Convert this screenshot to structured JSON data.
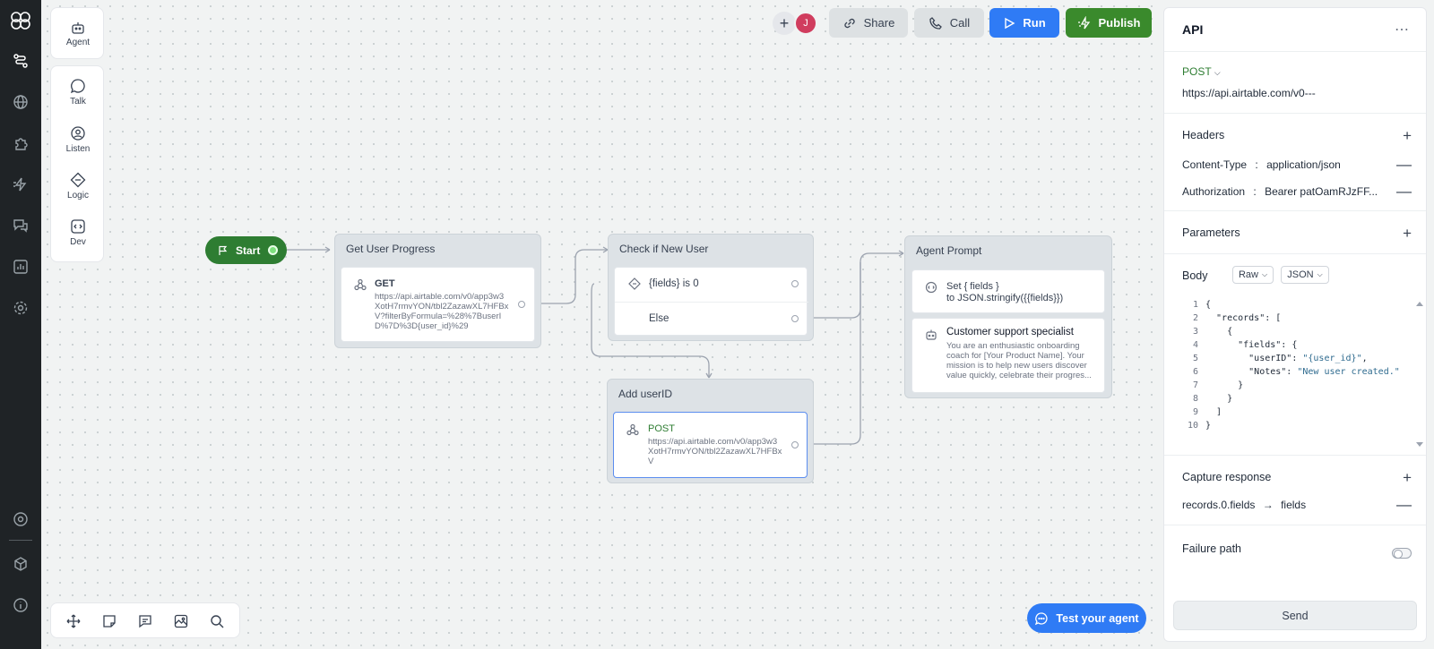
{
  "toolbar": {
    "agent": "Agent",
    "tools": [
      "Talk",
      "Listen",
      "Logic",
      "Dev"
    ]
  },
  "header": {
    "avatar_initial": "J",
    "share": "Share",
    "call": "Call",
    "run": "Run",
    "publish": "Publish"
  },
  "flow": {
    "start": "Start",
    "get_progress": {
      "title": "Get User Progress",
      "method": "GET",
      "url": "https://api.airtable.com/v0/app3w3XotH7rmvYON/tbl2ZazawXL7HFBxV?filterByFormula=%28%7BuserID%7D%3D{user_id}%29"
    },
    "check_new": {
      "title": "Check if New User",
      "condition": "{fields} is 0",
      "else": "Else"
    },
    "add_user": {
      "title": "Add userID",
      "method": "POST",
      "url": "https://api.airtable.com/v0/app3w3XotH7rmvYON/tbl2ZazawXL7HFBxV"
    },
    "agent_prompt": {
      "title": "Agent Prompt",
      "set_line1": "Set { fields }",
      "set_line2": "to JSON.stringify({{fields}})",
      "persona_title": "Customer support specialist",
      "persona_text": "You are an enthusiastic onboarding coach for [Your Product Name]. Your mission is to help new users discover value quickly, celebrate their progres..."
    }
  },
  "test_button": "Test your agent",
  "panel": {
    "title": "API",
    "method": "POST",
    "url": "https://api.airtable.com/v0---",
    "headers_label": "Headers",
    "headers": [
      {
        "key": "Content-Type",
        "sep": ":",
        "value": "application/json"
      },
      {
        "key": "Authorization",
        "sep": ":",
        "value": "Bearer patOamRJzFF..."
      }
    ],
    "parameters_label": "Parameters",
    "body_label": "Body",
    "body_format": "Raw",
    "body_type": "JSON",
    "code_lines": [
      {
        "n": "1",
        "t": "{"
      },
      {
        "n": "2",
        "t": "  \"records\": ["
      },
      {
        "n": "3",
        "t": "    {"
      },
      {
        "n": "4",
        "t": "      \"fields\": {"
      },
      {
        "n": "5",
        "t": "        \"userID\": \"{user_id}\","
      },
      {
        "n": "6",
        "t": "        \"Notes\": \"New user created.\""
      },
      {
        "n": "7",
        "t": "      }"
      },
      {
        "n": "8",
        "t": "    }"
      },
      {
        "n": "9",
        "t": "  ]"
      },
      {
        "n": "10",
        "t": "}"
      }
    ],
    "capture_label": "Capture response",
    "capture_from": "records.0.fields",
    "capture_arrow": "→",
    "capture_to": "fields",
    "failure_label": "Failure path",
    "send": "Send"
  }
}
